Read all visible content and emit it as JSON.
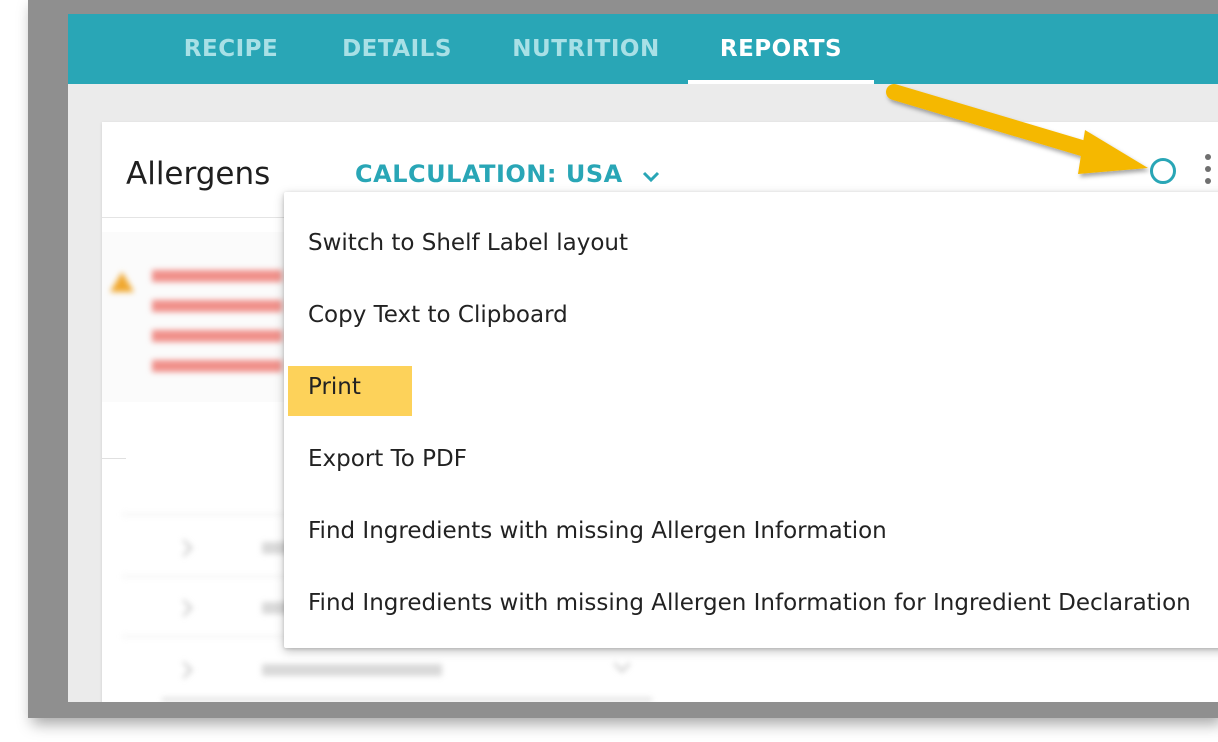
{
  "tabs": [
    {
      "label": "RECIPE",
      "active": false
    },
    {
      "label": "DETAILS",
      "active": false
    },
    {
      "label": "NUTRITION",
      "active": false
    },
    {
      "label": "REPORTS",
      "active": true
    }
  ],
  "card": {
    "title": "Allergens",
    "calculation_label": "CALCULATION: USA"
  },
  "menu": {
    "items": [
      {
        "label": "Switch to Shelf Label layout"
      },
      {
        "label": "Copy Text to Clipboard"
      },
      {
        "label": "Print",
        "highlighted": true
      },
      {
        "label": "Export To PDF"
      },
      {
        "label": "Find Ingredients with missing Allergen Information"
      },
      {
        "label": "Find Ingredients with missing Allergen Information for Ingredient Declaration"
      }
    ]
  },
  "colors": {
    "accent": "#29a6b6",
    "highlight": "#fdd25a",
    "annotation_arrow": "#f5b800"
  },
  "icons": [
    "chevron-down-icon",
    "info-icon",
    "more-vert-icon",
    "annotation-arrow-icon"
  ]
}
